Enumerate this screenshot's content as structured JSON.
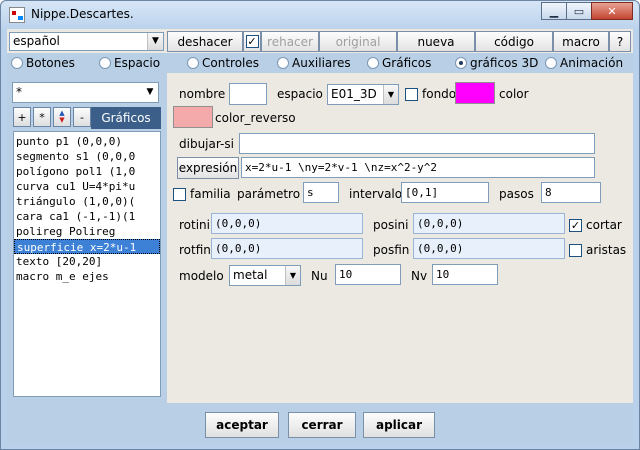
{
  "window": {
    "title": "Nippe.Descartes.",
    "minimize": "▁",
    "restore": "▭",
    "close": "✕"
  },
  "toolbar": {
    "language": "español",
    "deshacer": "deshacer",
    "deshacer_checked": "✓",
    "rehacer": "rehacer",
    "original": "original",
    "nueva": "nueva",
    "codigo": "código",
    "macro": "macro",
    "help": "?"
  },
  "tabs": [
    {
      "label": "Botones",
      "checked": false
    },
    {
      "label": "Espacio",
      "checked": false
    },
    {
      "label": "Controles",
      "checked": false
    },
    {
      "label": "Auxiliares",
      "checked": false
    },
    {
      "label": "Gráficos",
      "checked": false
    },
    {
      "label": "gráficos 3D",
      "checked": true
    },
    {
      "label": "Animación",
      "checked": false
    }
  ],
  "left": {
    "filter": "*",
    "add": "+",
    "star": "*",
    "remove": "-",
    "tab": "Gráficos",
    "items": [
      "punto p1 (0,0,0)",
      "segmento s1 (0,0,0",
      "polígono pol1 (1,0",
      "curva cu1 U=4*pi*u",
      "triángulo (1,0,0)(",
      "cara ca1 (-1,-1)(1",
      "polireg Polireg",
      "superficie x=2*u-1",
      "texto [20,20]",
      "macro m_e ejes"
    ],
    "selected_index": 7
  },
  "form": {
    "nombre_label": "nombre",
    "nombre_value": "",
    "espacio_label": "espacio",
    "espacio_value": "E01_3D",
    "fondo_label": "fondo",
    "color_label": "color",
    "color_value": "#ff00ff",
    "color_reverso_label": "color_reverso",
    "color_reverso_value": "#f4aaaa",
    "dibujar_si_label": "dibujar-si",
    "dibujar_si_value": "",
    "expresion_label": "expresión",
    "expresion_value": "x=2*u-1 \\ny=2*v-1 \\nz=x^2-y^2",
    "familia_label": "familia",
    "parametro_label": "parámetro",
    "parametro_value": "s",
    "intervalo_label": "intervalo",
    "intervalo_value": "[0,1]",
    "pasos_label": "pasos",
    "pasos_value": "8",
    "rotini_label": "rotini",
    "rotini_value": "(0,0,0)",
    "posini_label": "posini",
    "posini_value": "(0,0,0)",
    "cortar_label": "cortar",
    "cortar_checked": "✓",
    "rotfin_label": "rotfin",
    "rotfin_value": "(0,0,0)",
    "posfin_label": "posfin",
    "posfin_value": "(0,0,0)",
    "aristas_label": "aristas",
    "modelo_label": "modelo",
    "modelo_value": "metal",
    "nu_label": "Nu",
    "nu_value": "10",
    "nv_label": "Nv",
    "nv_value": "10"
  },
  "bottom": {
    "aceptar": "aceptar",
    "cerrar": "cerrar",
    "aplicar": "aplicar"
  }
}
